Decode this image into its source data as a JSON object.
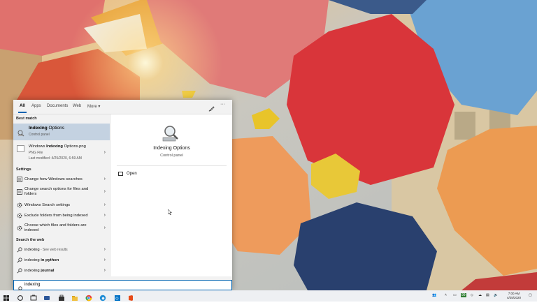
{
  "search": {
    "tabs": [
      "All",
      "Apps",
      "Documents",
      "Web",
      "More"
    ],
    "more_caret": "▾",
    "query": "indexing"
  },
  "best_match": {
    "heading": "Best match",
    "title_bold": "Indexing",
    "title_rest": " Options",
    "subtitle": "Control panel"
  },
  "file_result": {
    "title_pre": "Windows ",
    "title_bold": "Indexing",
    "title_post": " Options.png",
    "type": "PNG File",
    "modified": "Last modified: 4/25/2020, 6:59 AM"
  },
  "settings": {
    "heading": "Settings",
    "items": [
      "Change how Windows searches",
      "Change search options for files and folders",
      "Windows Search settings",
      "Exclude folders from being indexed",
      "Choose which files and folders are indexed"
    ]
  },
  "web": {
    "heading": "Search the web",
    "items": [
      {
        "bold": "",
        "text": "indexing",
        "hint": " - See web results"
      },
      {
        "text": "indexing ",
        "bold": "in python",
        "hint": ""
      },
      {
        "text": "indexing ",
        "bold": "journal",
        "hint": ""
      }
    ]
  },
  "preview": {
    "title": "Indexing Options",
    "subtitle": "Control panel",
    "action": "Open"
  },
  "taskbar": {
    "time": "7:00 AM",
    "date": "4/25/2020",
    "badge": "99"
  },
  "colors": {
    "accent": "#0063b1",
    "selected_bg": "#c4d2e1"
  }
}
